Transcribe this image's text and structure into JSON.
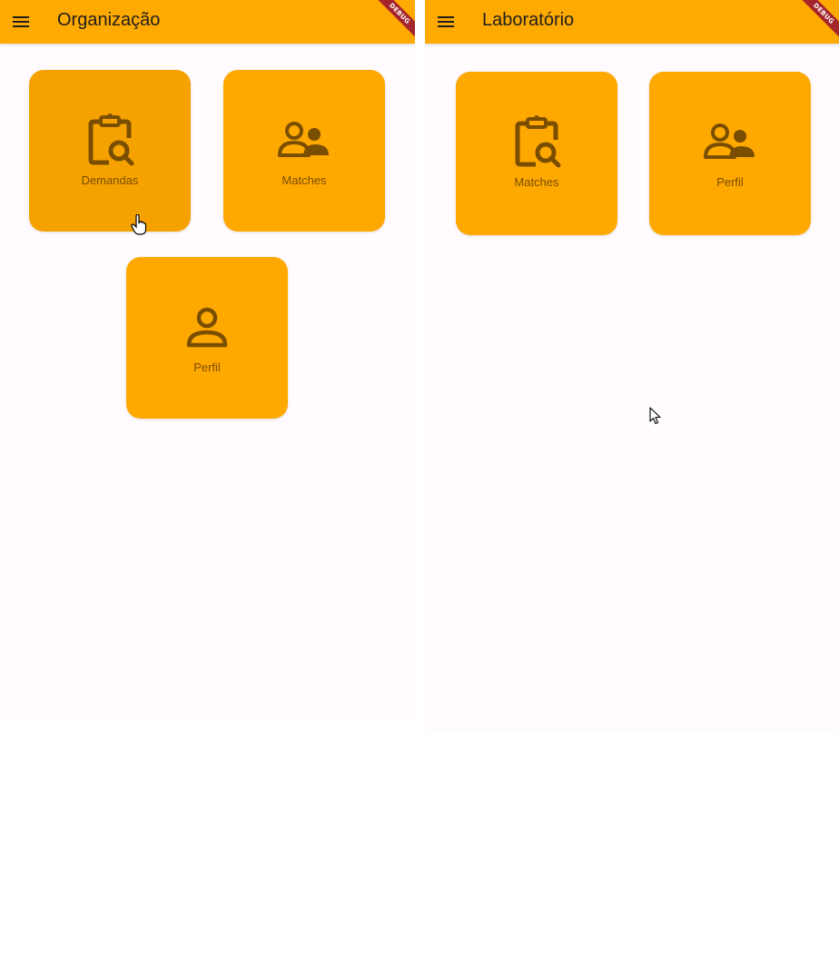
{
  "screens": [
    {
      "title": "Organização",
      "debug_banner": "DEBUG",
      "menu_icon": "hamburger-menu-icon",
      "tiles": [
        {
          "label": "Demandas",
          "icon": "clipboard-search-icon"
        },
        {
          "label": "Matches",
          "icon": "group-people-icon"
        },
        {
          "label": "Perfil",
          "icon": "person-icon"
        }
      ]
    },
    {
      "title": "Laboratório",
      "debug_banner": "DEBUG",
      "menu_icon": "hamburger-menu-icon",
      "tiles": [
        {
          "label": "Matches",
          "icon": "clipboard-search-icon"
        },
        {
          "label": "Perfil",
          "icon": "group-people-icon"
        }
      ]
    }
  ],
  "colors": {
    "app_bar": "#ffaa00",
    "tile": "#ffa800",
    "tile_hover": "#f5a200",
    "icon": "#7a4e00",
    "debug_ribbon": "#a4262c",
    "background": "#fffbfe"
  }
}
